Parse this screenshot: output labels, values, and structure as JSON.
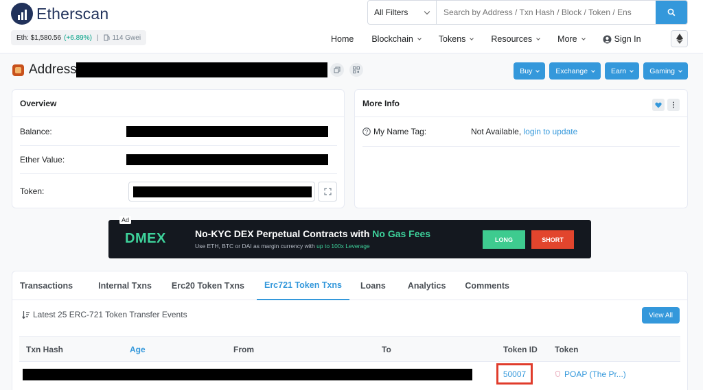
{
  "brand": {
    "name": "Etherscan"
  },
  "ticker": {
    "eth_label": "Eth: $1,580.56",
    "eth_change": "(+6.89%)",
    "separator": "|",
    "gas": "114 Gwei"
  },
  "search": {
    "filter": "All Filters",
    "placeholder": "Search by Address / Txn Hash / Block / Token / Ens"
  },
  "nav": {
    "items": [
      {
        "label": "Home",
        "dropdown": false
      },
      {
        "label": "Blockchain",
        "dropdown": true
      },
      {
        "label": "Tokens",
        "dropdown": true
      },
      {
        "label": "Resources",
        "dropdown": true
      },
      {
        "label": "More",
        "dropdown": true
      }
    ],
    "signin": "Sign In"
  },
  "address": {
    "title": "Address",
    "buttons": [
      "Buy",
      "Exchange",
      "Earn",
      "Gaming"
    ]
  },
  "overview": {
    "title": "Overview",
    "balance_label": "Balance:",
    "ether_value_label": "Ether Value:",
    "token_label": "Token:"
  },
  "more_info": {
    "title": "More Info",
    "name_tag_label": "My Name Tag:",
    "name_tag_value": "Not Available,",
    "name_tag_link": "login to update"
  },
  "ad": {
    "tag": "Ad",
    "brand": "DMEX",
    "headline_a": "No-KYC DEX Perpetual Contracts with ",
    "headline_b": "No Gas Fees",
    "sub_a": "Use ETH, BTC or DAI as margin currency with ",
    "sub_b": "up to 100x Leverage",
    "long": "LONG",
    "short": "SHORT"
  },
  "tabs": {
    "items": [
      "Transactions",
      "Internal Txns",
      "Erc20 Token Txns",
      "Erc721 Token Txns",
      "Loans",
      "Analytics",
      "Comments"
    ],
    "active": "Erc721 Token Txns"
  },
  "transfers": {
    "summary": "Latest 25 ERC-721 Token Transfer Events",
    "view_all": "View All",
    "columns": {
      "txn_hash": "Txn Hash",
      "age": "Age",
      "from": "From",
      "to": "To",
      "token_id": "Token ID",
      "token": "Token"
    },
    "rows": [
      {
        "token_id": "50007",
        "token": "POAP (The Pr...)"
      }
    ]
  },
  "colors": {
    "accent": "#3498db",
    "highlight_box": "#e03c2c",
    "positive": "#00a186"
  }
}
